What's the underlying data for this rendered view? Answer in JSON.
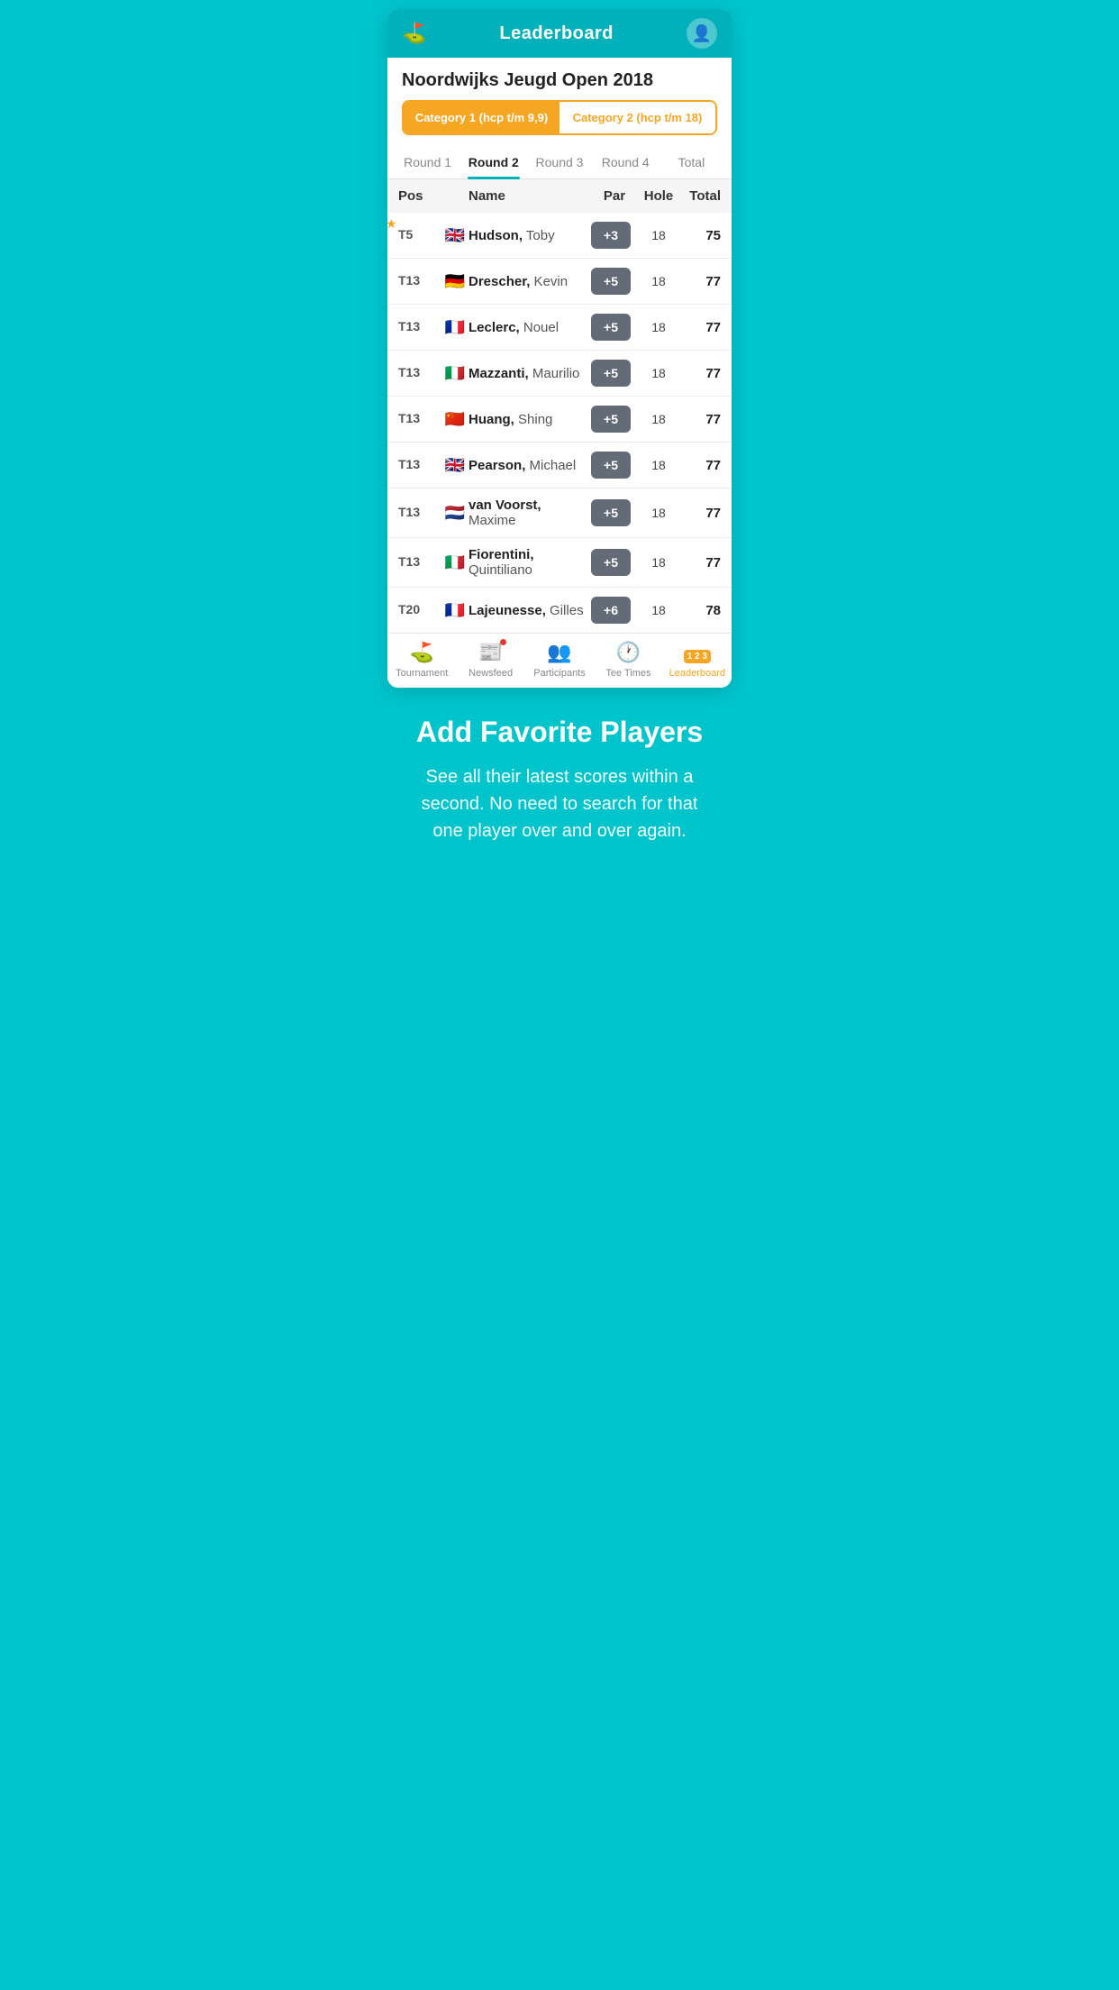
{
  "header": {
    "title": "Leaderboard",
    "person_icon": "👤"
  },
  "tournament": {
    "name": "Noordwijks Jeugd Open 2018",
    "categories": [
      {
        "label": "Category 1 (hcp t/m 9,9)",
        "active": true
      },
      {
        "label": "Category 2 (hcp t/m 18)",
        "active": false
      }
    ],
    "rounds": [
      {
        "label": "Round 1",
        "active": false
      },
      {
        "label": "Round 2",
        "active": true
      },
      {
        "label": "Round 3",
        "active": false
      },
      {
        "label": "Round 4",
        "active": false
      },
      {
        "label": "Total",
        "active": false
      }
    ],
    "table": {
      "headers": {
        "pos": "Pos",
        "name": "Name",
        "par": "Par",
        "hole": "Hole",
        "total": "Total"
      },
      "rows": [
        {
          "pos": "T5",
          "flag": "🇬🇧",
          "name_bold": "Hudson,",
          "name_light": " Toby",
          "par": "+3",
          "hole": "18",
          "total": "75",
          "star": true
        },
        {
          "pos": "T13",
          "flag": "🇩🇪",
          "name_bold": "Drescher,",
          "name_light": " Kevin",
          "par": "+5",
          "hole": "18",
          "total": "77",
          "star": false
        },
        {
          "pos": "T13",
          "flag": "🇫🇷",
          "name_bold": "Leclerc,",
          "name_light": " Nouel",
          "par": "+5",
          "hole": "18",
          "total": "77",
          "star": false
        },
        {
          "pos": "T13",
          "flag": "🇮🇹",
          "name_bold": "Mazzanti,",
          "name_light": " Maurilio",
          "par": "+5",
          "hole": "18",
          "total": "77",
          "star": false
        },
        {
          "pos": "T13",
          "flag": "🇨🇳",
          "name_bold": "Huang,",
          "name_light": " Shing",
          "par": "+5",
          "hole": "18",
          "total": "77",
          "star": false
        },
        {
          "pos": "T13",
          "flag": "🇬🇧",
          "name_bold": "Pearson,",
          "name_light": " Michael",
          "par": "+5",
          "hole": "18",
          "total": "77",
          "star": false
        },
        {
          "pos": "T13",
          "flag": "🇳🇱",
          "name_bold": "van Voorst,",
          "name_light": " Maxime",
          "par": "+5",
          "hole": "18",
          "total": "77",
          "star": false
        },
        {
          "pos": "T13",
          "flag": "🇮🇹",
          "name_bold": "Fiorentini,",
          "name_light": " Quintiliano",
          "par": "+5",
          "hole": "18",
          "total": "77",
          "star": false
        },
        {
          "pos": "T20",
          "flag": "🇫🇷",
          "name_bold": "Lajeunesse,",
          "name_light": " Gilles",
          "par": "+6",
          "hole": "18",
          "total": "78",
          "star": false
        }
      ]
    }
  },
  "bottom_nav": [
    {
      "label": "Tournament",
      "icon": "⛳",
      "active": false,
      "dot": false
    },
    {
      "label": "Newsfeed",
      "icon": "📰",
      "active": false,
      "dot": true
    },
    {
      "label": "Participants",
      "icon": "👥",
      "active": false,
      "dot": false
    },
    {
      "label": "Tee Times",
      "icon": "🕐",
      "active": false,
      "dot": false
    },
    {
      "label": "Leaderboard",
      "icon": "🏆",
      "active": true,
      "dot": false
    }
  ],
  "promo": {
    "title": "Add Favorite Players",
    "text": "See all their latest scores within a second. No need to search for that one player over and over again."
  }
}
